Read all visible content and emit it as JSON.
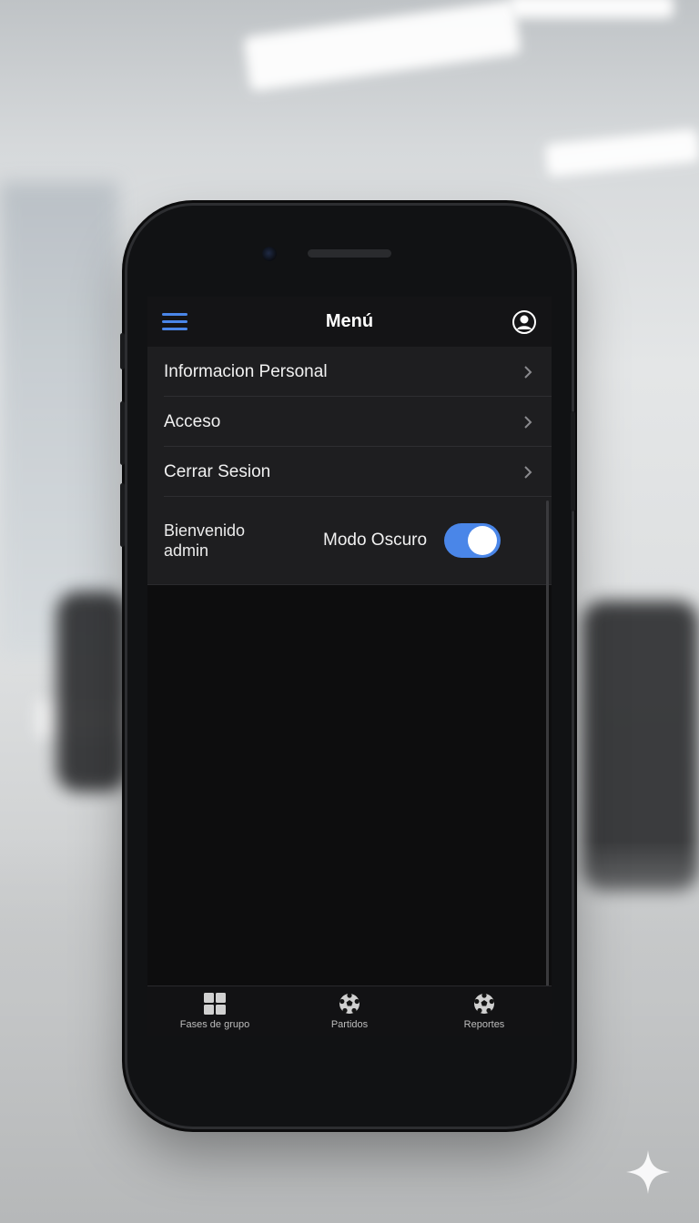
{
  "header": {
    "title": "Menú",
    "menu_icon": "hamburger-menu-icon",
    "profile_icon": "user-circle-icon",
    "accent_color": "#4a86e8"
  },
  "menu": {
    "items": [
      {
        "label": "Informacion Personal",
        "icon": "chevron-right-icon"
      },
      {
        "label": "Acceso",
        "icon": "chevron-right-icon"
      },
      {
        "label": "Cerrar Sesion",
        "icon": "chevron-right-icon"
      }
    ]
  },
  "welcome": {
    "greeting": "Bienvenido",
    "username": "admin",
    "dark_mode_label": "Modo Oscuro",
    "dark_mode_on": true
  },
  "bottom_nav": {
    "items": [
      {
        "label": "Fases de grupo",
        "icon": "grid-icon"
      },
      {
        "label": "Partidos",
        "icon": "soccer-ball-icon"
      },
      {
        "label": "Reportes",
        "icon": "soccer-ball-icon"
      }
    ]
  },
  "watermark_icon": "sparkle-icon"
}
